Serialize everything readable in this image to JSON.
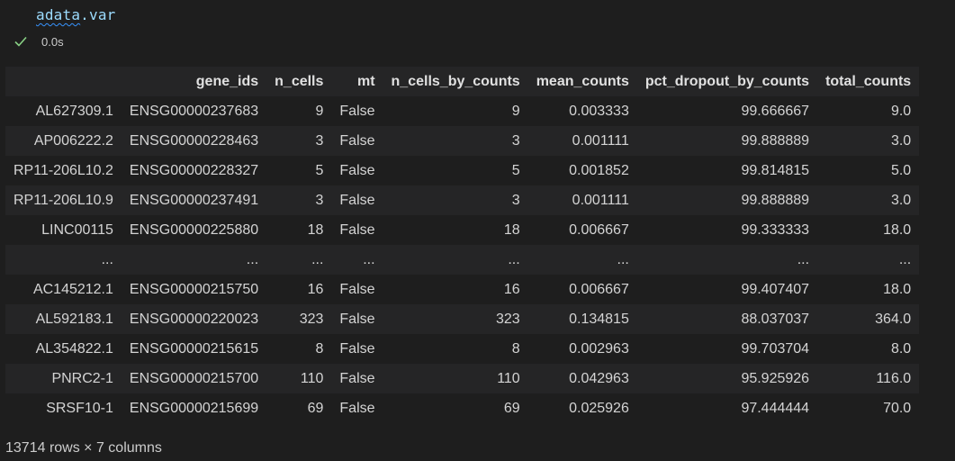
{
  "cell": {
    "code_obj": "adata",
    "code_sep": ".",
    "code_attr": "var",
    "exec_time": "0.0s",
    "status_color": "#89d185"
  },
  "table": {
    "columns": [
      "",
      "gene_ids",
      "n_cells",
      "mt",
      "n_cells_by_counts",
      "mean_counts",
      "pct_dropout_by_counts",
      "total_counts"
    ],
    "rows": [
      [
        "AL627309.1",
        "ENSG00000237683",
        "9",
        "False",
        "9",
        "0.003333",
        "99.666667",
        "9.0"
      ],
      [
        "AP006222.2",
        "ENSG00000228463",
        "3",
        "False",
        "3",
        "0.001111",
        "99.888889",
        "3.0"
      ],
      [
        "RP11-206L10.2",
        "ENSG00000228327",
        "5",
        "False",
        "5",
        "0.001852",
        "99.814815",
        "5.0"
      ],
      [
        "RP11-206L10.9",
        "ENSG00000237491",
        "3",
        "False",
        "3",
        "0.001111",
        "99.888889",
        "3.0"
      ],
      [
        "LINC00115",
        "ENSG00000225880",
        "18",
        "False",
        "18",
        "0.006667",
        "99.333333",
        "18.0"
      ],
      [
        "...",
        "...",
        "...",
        "...",
        "...",
        "...",
        "...",
        "..."
      ],
      [
        "AC145212.1",
        "ENSG00000215750",
        "16",
        "False",
        "16",
        "0.006667",
        "99.407407",
        "18.0"
      ],
      [
        "AL592183.1",
        "ENSG00000220023",
        "323",
        "False",
        "323",
        "0.134815",
        "88.037037",
        "364.0"
      ],
      [
        "AL354822.1",
        "ENSG00000215615",
        "8",
        "False",
        "8",
        "0.002963",
        "99.703704",
        "8.0"
      ],
      [
        "PNRC2-1",
        "ENSG00000215700",
        "110",
        "False",
        "110",
        "0.042963",
        "95.925926",
        "116.0"
      ],
      [
        "SRSF10-1",
        "ENSG00000215699",
        "69",
        "False",
        "69",
        "0.025926",
        "97.444444",
        "70.0"
      ]
    ],
    "footer": "13714 rows × 7 columns"
  }
}
